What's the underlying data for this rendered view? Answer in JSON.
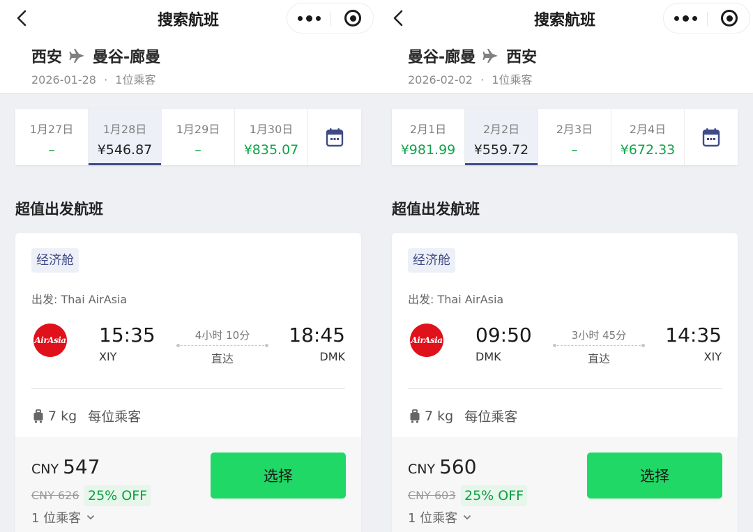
{
  "colors": {
    "accent": "#3f4a87",
    "price_green": "#12a34a",
    "button_green": "#20d866",
    "brand_red": "#e0111b"
  },
  "panels": [
    {
      "nav": {
        "title": "搜索航班"
      },
      "route": {
        "from": "西安",
        "to": "曼谷-廊曼",
        "date": "2026-01-28",
        "passengers": "1位乘客",
        "sep": "·"
      },
      "dates": [
        {
          "label": "1月27日",
          "price": "–"
        },
        {
          "label": "1月28日",
          "price": "¥546.87",
          "selected": true
        },
        {
          "label": "1月29日",
          "price": "–"
        },
        {
          "label": "1月30日",
          "price": "¥835.07"
        }
      ],
      "section_title": "超值出发航班",
      "flight": {
        "cabin": "经济舱",
        "departure_airline": "出发: Thai AirAsia",
        "logo_text": "AirAsia",
        "dep_time": "15:35",
        "dep_code": "XIY",
        "duration": "4小时 10分",
        "stops": "直达",
        "arr_time": "18:45",
        "arr_code": "DMK",
        "baggage": "7 kg",
        "baggage_note": "每位乘客",
        "currency": "CNY",
        "price": "547",
        "original_price": "CNY 626",
        "discount": "25% OFF",
        "pax_select": "1 位乘客",
        "select_label": "选择"
      }
    },
    {
      "nav": {
        "title": "搜索航班"
      },
      "route": {
        "from": "曼谷-廊曼",
        "to": "西安",
        "date": "2026-02-02",
        "passengers": "1位乘客",
        "sep": "·"
      },
      "dates": [
        {
          "label": "2月1日",
          "price": "¥981.99"
        },
        {
          "label": "2月2日",
          "price": "¥559.72",
          "selected": true
        },
        {
          "label": "2月3日",
          "price": "–"
        },
        {
          "label": "2月4日",
          "price": "¥672.33"
        }
      ],
      "section_title": "超值出发航班",
      "flight": {
        "cabin": "经济舱",
        "departure_airline": "出发: Thai AirAsia",
        "logo_text": "AirAsia",
        "dep_time": "09:50",
        "dep_code": "DMK",
        "duration": "3小时 45分",
        "stops": "直达",
        "arr_time": "14:35",
        "arr_code": "XIY",
        "baggage": "7 kg",
        "baggage_note": "每位乘客",
        "currency": "CNY",
        "price": "560",
        "original_price": "CNY 603",
        "discount": "25% OFF",
        "pax_select": "1 位乘客",
        "select_label": "选择"
      }
    }
  ]
}
